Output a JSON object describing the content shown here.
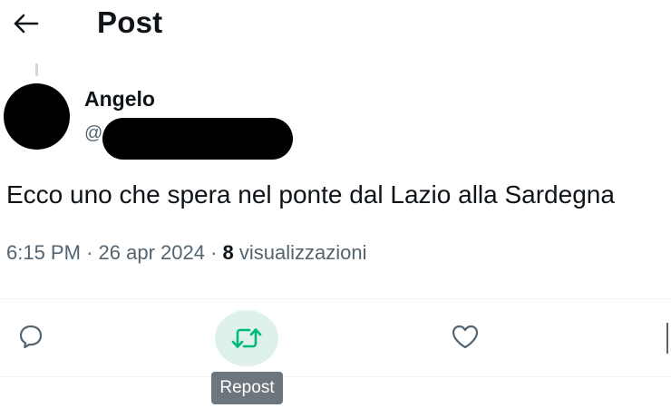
{
  "header": {
    "title": "Post",
    "back_icon": "arrow-left-icon"
  },
  "post": {
    "author_name": "Angelo",
    "handle_prefix": "@",
    "text": "Ecco uno che spera nel ponte dal Lazio alla Sardegna",
    "time": "6:15 PM",
    "separator": "·",
    "date": "26 apr 2024",
    "views_count": "8",
    "views_label": "visualizzazioni"
  },
  "actions": {
    "reply_icon": "comment-bubble-icon",
    "repost_icon": "repost-icon",
    "like_icon": "heart-icon",
    "repost_tooltip": "Repost"
  },
  "colors": {
    "text_primary": "#0f1419",
    "text_secondary": "#536471",
    "repost_accent": "#00ba7c",
    "repost_highlight": "#def1eb",
    "tooltip_bg": "#6e767d"
  }
}
